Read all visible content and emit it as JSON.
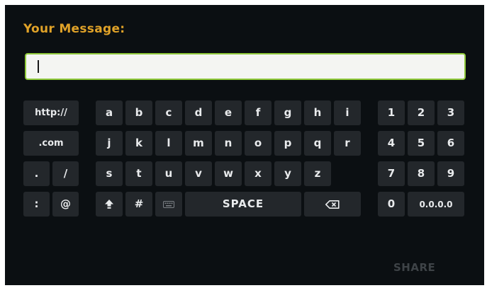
{
  "message": {
    "title": "Your Message:",
    "value": ""
  },
  "keyboard": {
    "left": [
      [
        "http://"
      ],
      [
        ".com"
      ],
      [
        ".",
        "/"
      ],
      [
        ":",
        "@"
      ]
    ],
    "letters": [
      [
        "a",
        "b",
        "c",
        "d",
        "e",
        "f",
        "g",
        "h",
        "i"
      ],
      [
        "j",
        "k",
        "l",
        "m",
        "n",
        "o",
        "p",
        "q",
        "r"
      ],
      [
        "s",
        "t",
        "u",
        "v",
        "w",
        "x",
        "y",
        "z"
      ]
    ],
    "bottom": {
      "hash": "#",
      "space": "SPACE"
    },
    "numbers": [
      [
        "1",
        "2",
        "3"
      ],
      [
        "4",
        "5",
        "6"
      ],
      [
        "7",
        "8",
        "9"
      ]
    ],
    "zero": "0",
    "ip": "0.0.0.0"
  },
  "footer": {
    "share_label": "SHARE"
  },
  "icons": {
    "shift": "shift-icon",
    "keyboard": "keyboard-icon",
    "backspace": "backspace-icon"
  }
}
